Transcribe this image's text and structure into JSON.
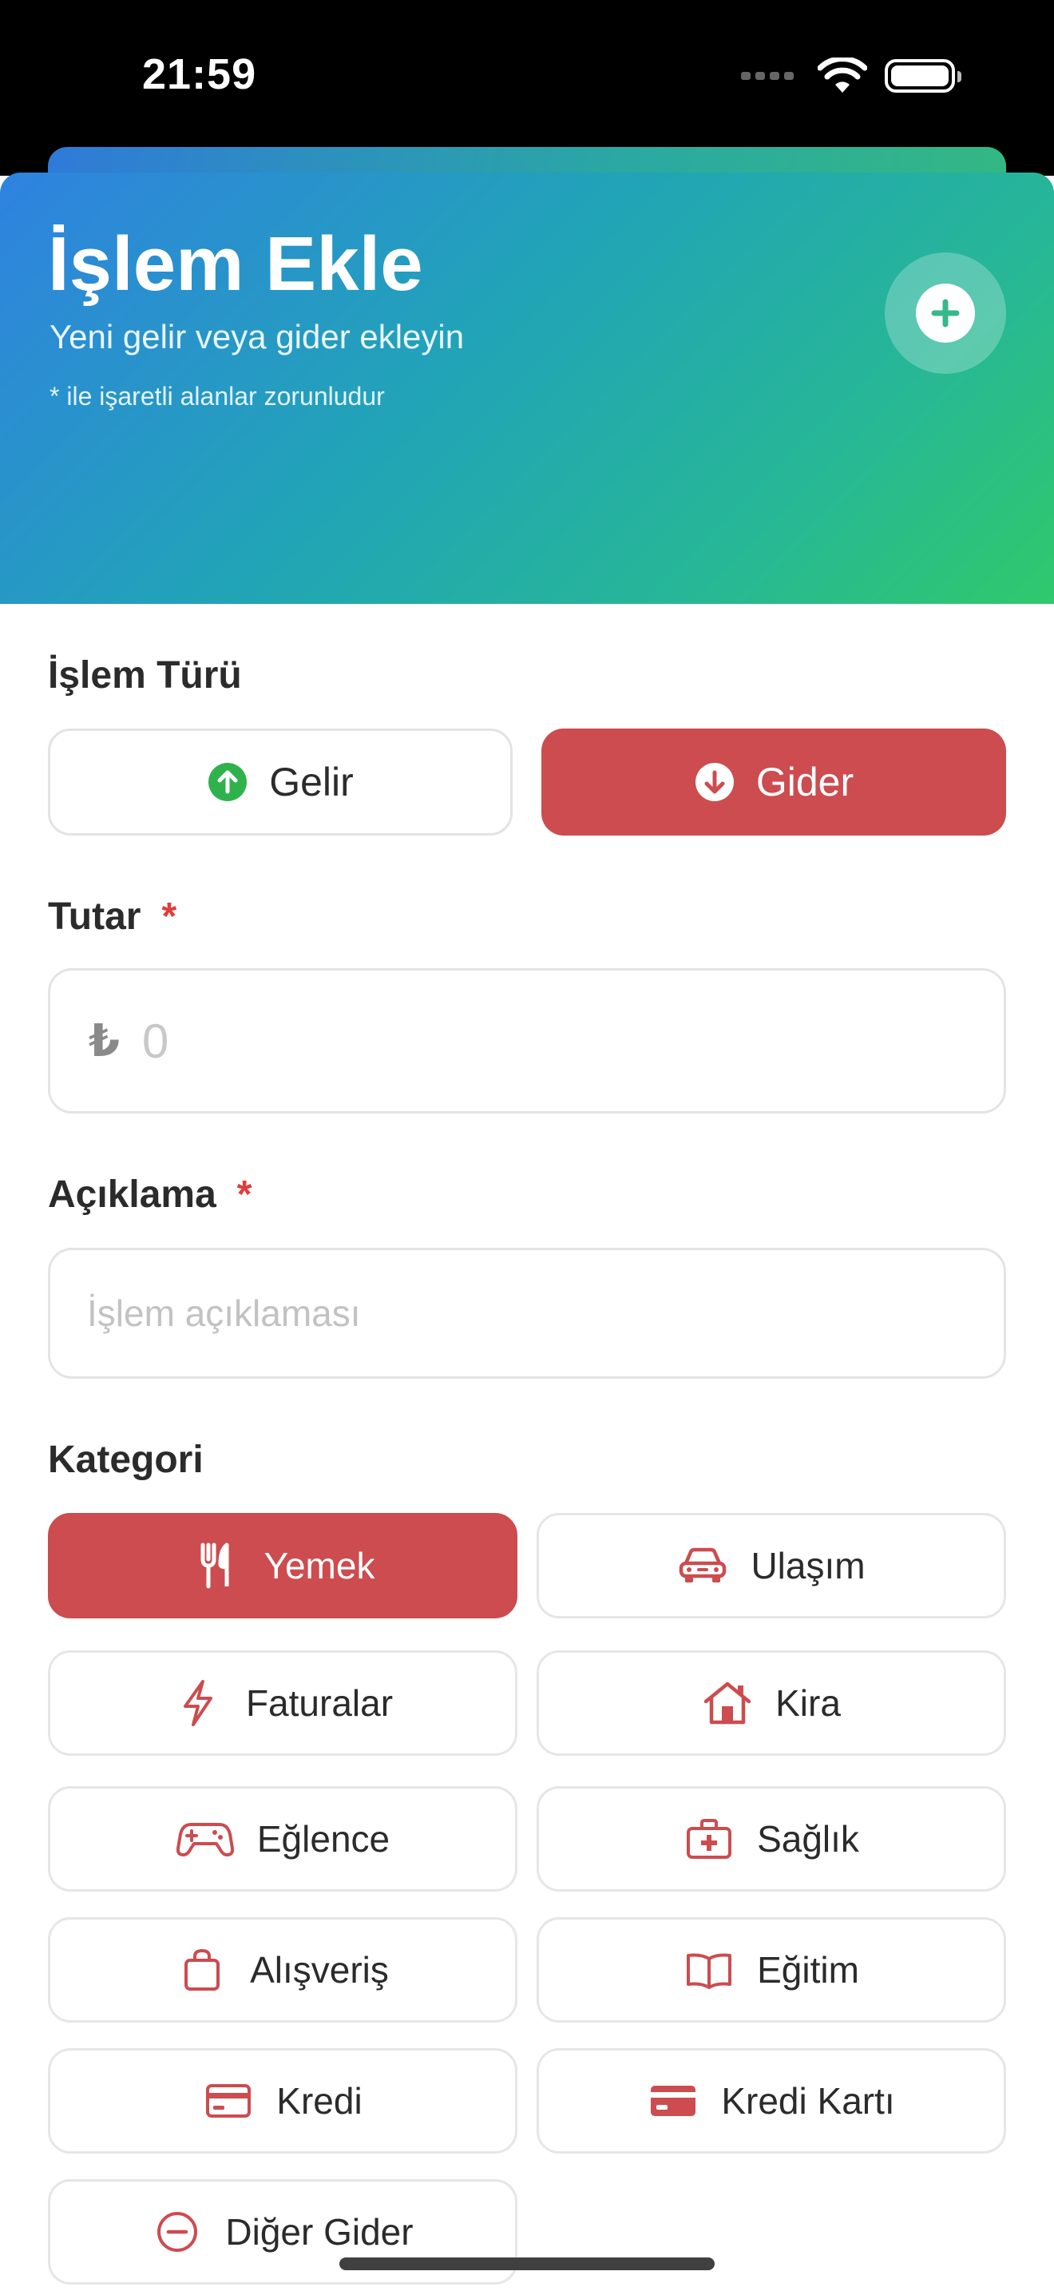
{
  "status_bar": {
    "time": "21:59"
  },
  "header": {
    "title": "İşlem Ekle",
    "subtitle": "Yeni gelir veya gider ekleyin",
    "note": "* ile işaretli alanlar zorunludur"
  },
  "transaction_type": {
    "label": "İşlem Türü",
    "options": [
      {
        "label": "Gelir",
        "icon": "arrow-up-circle-icon",
        "selected": false
      },
      {
        "label": "Gider",
        "icon": "arrow-down-circle-icon",
        "selected": true
      }
    ]
  },
  "amount": {
    "label": "Tutar",
    "required_mark": "*",
    "currency": "₺",
    "placeholder": "0"
  },
  "description": {
    "label": "Açıklama",
    "required_mark": "*",
    "placeholder": "İşlem açıklaması"
  },
  "category": {
    "label": "Kategori",
    "items": [
      {
        "label": "Yemek",
        "icon": "fork-knife-icon",
        "selected": true
      },
      {
        "label": "Ulaşım",
        "icon": "car-icon",
        "selected": false
      },
      {
        "label": "Faturalar",
        "icon": "bolt-icon",
        "selected": false
      },
      {
        "label": "Kira",
        "icon": "house-icon",
        "selected": false
      },
      {
        "label": "Eğlence",
        "icon": "gamepad-icon",
        "selected": false
      },
      {
        "label": "Sağlık",
        "icon": "medkit-icon",
        "selected": false
      },
      {
        "label": "Alışveriş",
        "icon": "shopping-bag-icon",
        "selected": false
      },
      {
        "label": "Eğitim",
        "icon": "book-icon",
        "selected": false
      },
      {
        "label": "Kredi",
        "icon": "credit-card-outline-icon",
        "selected": false
      },
      {
        "label": "Kredi Kartı",
        "icon": "credit-card-filled-icon",
        "selected": false
      },
      {
        "label": "Diğer Gider",
        "icon": "minus-circle-icon",
        "selected": false
      }
    ]
  },
  "colors": {
    "accent_red": "#cc4c4f",
    "income_green": "#2fb24c",
    "gradient_start": "#2f82e0",
    "gradient_end": "#30c96c"
  }
}
